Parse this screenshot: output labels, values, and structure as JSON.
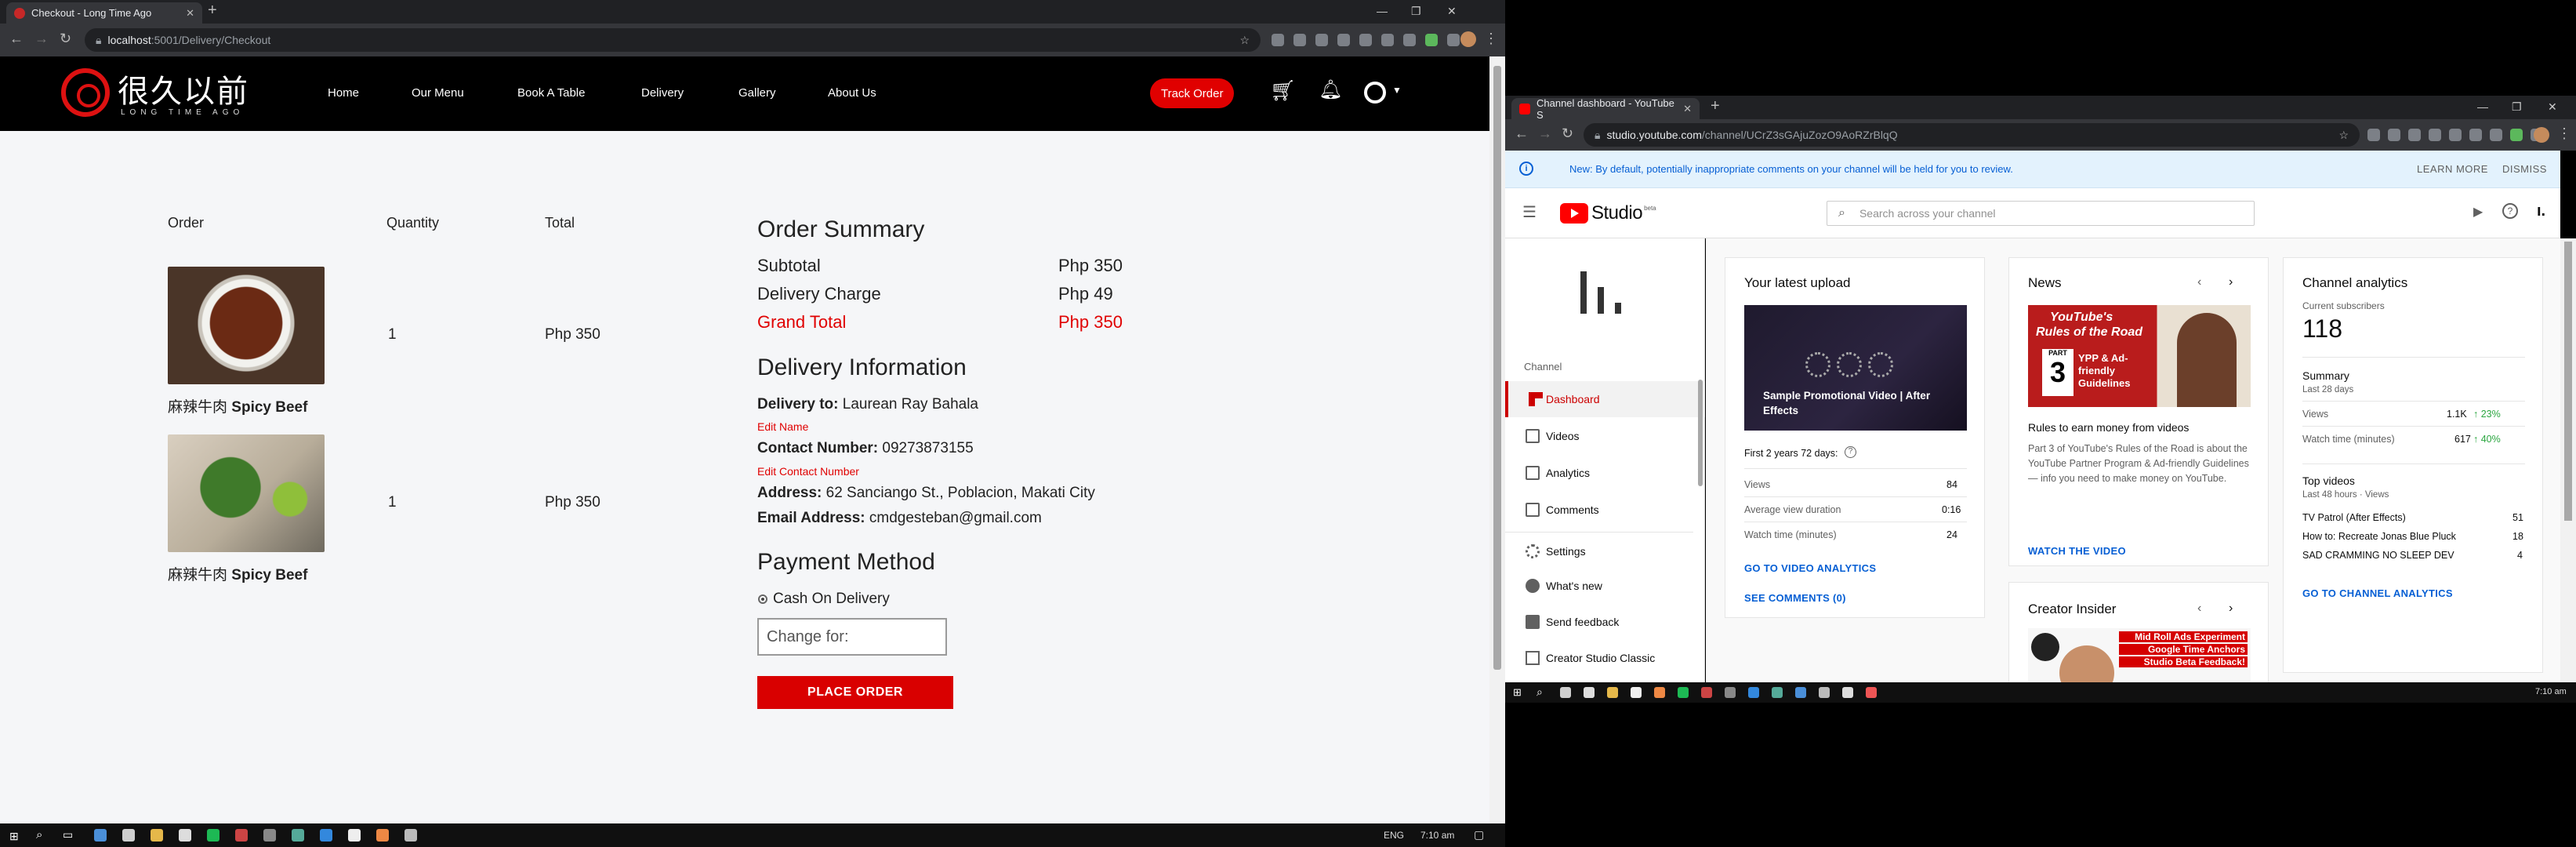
{
  "left_browser": {
    "tab_title": "Checkout - Long Time Ago",
    "url_host": "localhost",
    "url_path": ":5001/Delivery/Checkout"
  },
  "site": {
    "logo_text": "很久以前",
    "logo_sub": "LONG TIME AGO",
    "nav": [
      "Home",
      "Our Menu",
      "Book A Table",
      "Delivery",
      "Gallery",
      "About Us"
    ],
    "track_order": "Track Order"
  },
  "cart": {
    "headers": {
      "order": "Order",
      "quantity": "Quantity",
      "total": "Total"
    },
    "items": [
      {
        "name_cn": "麻辣牛肉",
        "name_en": "Spicy Beef",
        "qty": "1",
        "total": "Php 350"
      },
      {
        "name_cn": "麻辣牛肉",
        "name_en": "Spicy Beef",
        "qty": "1",
        "total": "Php 350"
      }
    ]
  },
  "summary": {
    "title": "Order Summary",
    "subtotal_label": "Subtotal",
    "subtotal": "Php 350",
    "delivery_label": "Delivery Charge",
    "delivery": "Php 49",
    "grand_label": "Grand Total",
    "grand": "Php 350"
  },
  "delivery_info": {
    "title": "Delivery Information",
    "to_label": "Delivery to:",
    "to": "Laurean Ray Bahala",
    "edit_name": "Edit Name",
    "contact_label": "Contact Number:",
    "contact": "09273873155",
    "edit_contact": "Edit Contact Number",
    "address_label": "Address:",
    "address": "62 Sanciango St., Poblacion, Makati City",
    "email_label": "Email Address:",
    "email": "cmdgesteban@gmail.com"
  },
  "payment": {
    "title": "Payment Method",
    "option": "Cash On Delivery",
    "change_placeholder": "Change for:",
    "place_order": "PLACE ORDER"
  },
  "left_taskbar": {
    "lang": "ENG",
    "time": "7:10 am"
  },
  "right_browser": {
    "tab_title": "Channel dashboard - YouTube S",
    "url_host": "studio.youtube.com",
    "url_path": "/channel/UCrZ3sGAjuZozO9AoRZrBlqQ"
  },
  "notice": {
    "message": "New: By default, potentially inappropriate comments on your channel will be held for you to review.",
    "learn_more": "LEARN MORE",
    "dismiss": "DISMISS"
  },
  "studio": {
    "logo": "Studio",
    "beta": "beta",
    "search_placeholder": "Search across your channel",
    "channel_label": "Channel",
    "sidebar": [
      "Dashboard",
      "Videos",
      "Analytics",
      "Comments",
      "Settings",
      "What's new",
      "Send feedback",
      "Creator Studio Classic"
    ]
  },
  "latest_upload": {
    "title": "Your latest upload",
    "video_title": "Sample Promotional Video | After Effects",
    "period": "First 2 years 72 days:",
    "rows": [
      {
        "label": "Views",
        "value": "84"
      },
      {
        "label": "Average view duration",
        "value": "0:16"
      },
      {
        "label": "Watch time (minutes)",
        "value": "24"
      }
    ],
    "link1": "GO TO VIDEO ANALYTICS",
    "link2": "SEE COMMENTS (0)"
  },
  "news": {
    "title": "News",
    "thumb_line1": "YouTube's",
    "thumb_line2": "Rules of the Road",
    "part_word": "PART",
    "part_num": "3",
    "thumb_tag": "YPP & Ad-friendly Guidelines",
    "headline": "Rules to earn money from videos",
    "body": "Part 3 of YouTube's Rules of the Road is about the YouTube Partner Program & Ad-friendly Guidelines— info you need to make money on YouTube.",
    "link": "WATCH THE VIDEO"
  },
  "creator_insider": {
    "title": "Creator Insider",
    "thumb_lines": [
      "Mid Roll Ads Experiment",
      "Google Time Anchors",
      "Studio Beta Feedback!"
    ]
  },
  "analytics": {
    "title": "Channel analytics",
    "subs_label": "Current subscribers",
    "subs": "118",
    "summary_title": "Summary",
    "summary_period": "Last 28 days",
    "rows": [
      {
        "label": "Views",
        "value": "1.1K",
        "change": "23%"
      },
      {
        "label": "Watch time (minutes)",
        "value": "617",
        "change": "40%"
      }
    ],
    "top_title": "Top videos",
    "top_period": "Last 48 hours · Views",
    "top_videos": [
      {
        "title": "TV Patrol (After Effects)",
        "views": "51"
      },
      {
        "title": "How to: Recreate Jonas Blue Pluck",
        "views": "18"
      },
      {
        "title": "SAD CRAMMING NO SLEEP DEV",
        "views": "4"
      }
    ],
    "link": "GO TO CHANNEL ANALYTICS"
  },
  "right_taskbar": {
    "time": "7:10 am"
  },
  "colors": {
    "brand_red": "#e00000",
    "yt_red": "#cc0000",
    "link_blue": "#065fd4"
  }
}
